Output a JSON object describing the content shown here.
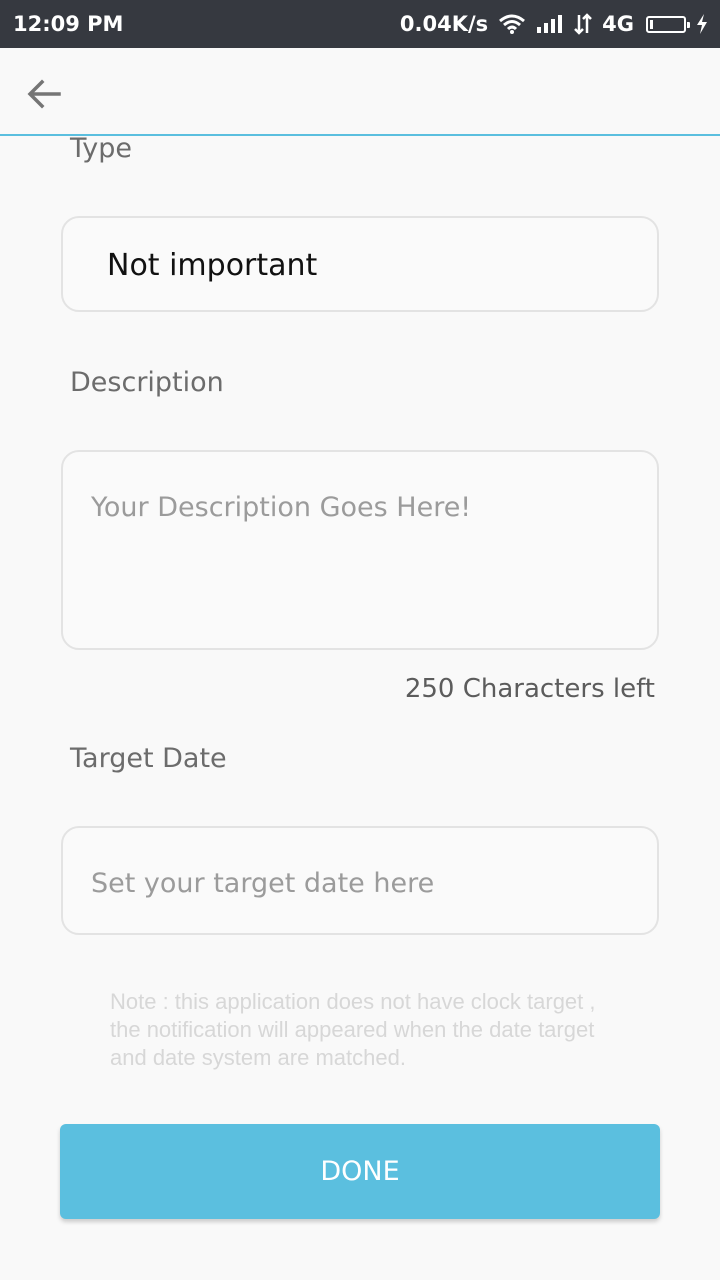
{
  "status_bar": {
    "time": "12:09 PM",
    "network_speed": "0.04K/s",
    "network_type": "4G",
    "icons": [
      "wifi-icon",
      "signal-icon",
      "data-transfer-icon",
      "battery-icon",
      "charging-icon"
    ]
  },
  "app_bar": {
    "back_icon": "arrow-left-icon",
    "accent_color": "#5bbfdf"
  },
  "form": {
    "type_label": "Type",
    "type_value": "Not important",
    "description_label": "Description",
    "description_placeholder": "Your Description Goes Here!",
    "chars_left": "250 Characters left",
    "target_date_label": "Target Date",
    "target_date_placeholder": "Set your target date here",
    "note": "Note : this application does not have clock target , the notification will appeared when the date target and date system are matched.",
    "done_label": "DONE"
  }
}
